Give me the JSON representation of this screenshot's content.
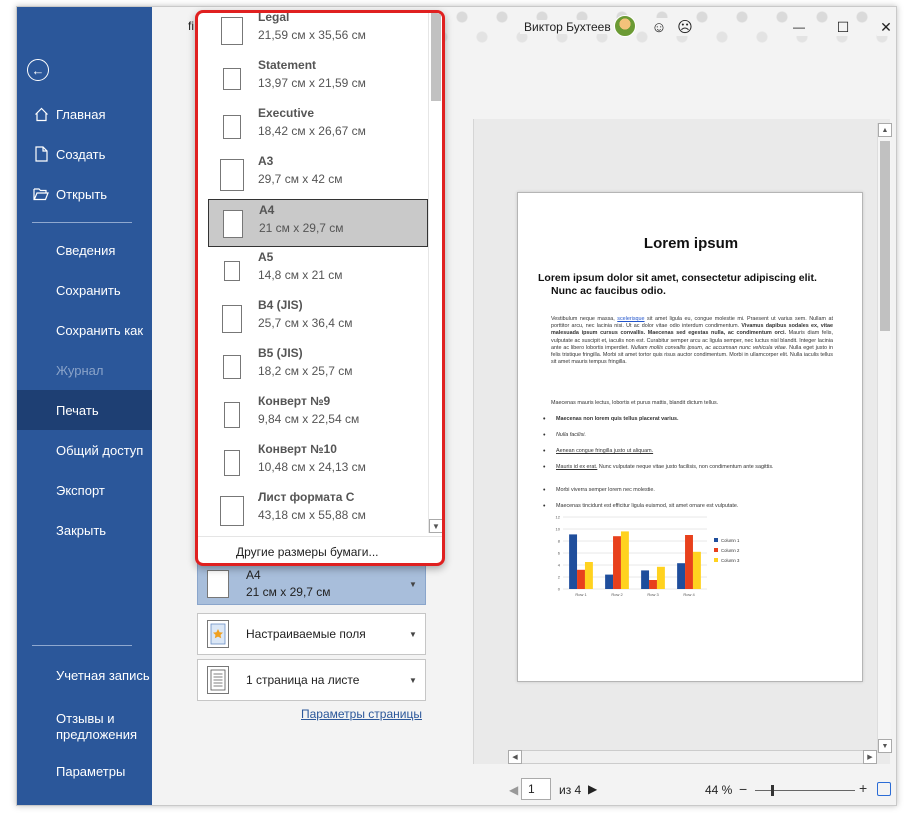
{
  "app": {
    "doc_title_fragment": "fi",
    "user_name": "Виктор Бухтеев",
    "smile_icon": "☺",
    "frown_icon": "☹",
    "minimize_icon": "—",
    "maximize_icon": "☐",
    "close_icon": "✕"
  },
  "sidebar": {
    "back_icon": "←",
    "items": [
      {
        "label": "Главная"
      },
      {
        "label": "Создать"
      },
      {
        "label": "Открыть"
      },
      {
        "label": "Сведения"
      },
      {
        "label": "Сохранить"
      },
      {
        "label": "Сохранить как"
      },
      {
        "label": "Журнал"
      },
      {
        "label": "Печать"
      },
      {
        "label": "Общий доступ"
      },
      {
        "label": "Экспорт"
      },
      {
        "label": "Закрыть"
      },
      {
        "label": "Учетная запись"
      },
      {
        "label": "Отзывы и предложения"
      },
      {
        "label": "Параметры"
      }
    ]
  },
  "dropdown": {
    "papers": [
      {
        "name": "Legal",
        "size": "21,59 см x 35,56 см"
      },
      {
        "name": "Statement",
        "size": "13,97 см x 21,59 см"
      },
      {
        "name": "Executive",
        "size": "18,42 см x 26,67 см"
      },
      {
        "name": "A3",
        "size": "29,7 см x 42 см"
      },
      {
        "name": "A4",
        "size": "21 см x 29,7 см"
      },
      {
        "name": "A5",
        "size": "14,8 см x 21 см"
      },
      {
        "name": "B4 (JIS)",
        "size": "25,7 см x 36,4 см"
      },
      {
        "name": "B5 (JIS)",
        "size": "18,2 см x 25,7 см"
      },
      {
        "name": "Конверт №9",
        "size": "9,84 см x 22,54 см"
      },
      {
        "name": "Конверт №10",
        "size": "10,48 см x 24,13 см"
      },
      {
        "name": "Лист формата C",
        "size": "43,18 см x 55,88 см"
      }
    ],
    "more_sizes": "Другие размеры бумаги...",
    "down_arrow": "▼"
  },
  "settings": {
    "paper": {
      "line1": "A4",
      "line2": "21 см x 29,7 см"
    },
    "margins": "Настраиваемые поля",
    "pages_per_sheet": "1 страница на листе",
    "arrow": "▼",
    "page_setup_link": "Параметры страницы"
  },
  "preview": {
    "title": "Lorem ipsum",
    "subtitle_1": "Lorem ipsum dolor sit amet, consectetur adipiscing elit.",
    "subtitle_2": "Nunc ac faucibus odio.",
    "para_1_a": "Vestibulum neque massa, ",
    "para_1_link": "scelerisque",
    "para_1_b": " sit amet ligula eu, congue molestie mi. Praesent ut varius sem. Nullam at porttitor arcu, nec lacinia nisi. Ut ac dolor vitae odio interdum condimentum. ",
    "para_1_bold": "Vivamus dapibus sodales ex, vitae malesuada ipsum cursus convallis. Maecenas sed egestas nulla, ac condimentum orci.",
    "para_1_c": " Mauris diam felis, vulputate ac suscipit et, iaculis non est. Curabitur semper arcu ac ligula semper, nec luctus nisl blandit. Integer lacinia ante ac libero lobortis imperdiet. ",
    "para_1_italic": "Nullam mollis convallis ipsum, ac accumsan nunc vehicula vitae.",
    "para_1_d": " Nulla eget justo in felis tristique fringilla. Morbi sit amet tortor quis risus auctor condimentum. Morbi in ullamcorper elit. Nulla iaculis tellus sit amet mauris tempus fringilla.",
    "para_2": "Maecenas mauris lectus, lobortis et purus mattis, blandit dictum tellus.",
    "bullets": {
      "b1": "Maecenas non lorem quis tellus placerat varius.",
      "b2": "Nulla facilisi.",
      "b3": "Aenean congue fringilla justo ut aliquam.",
      "b4_link": "Mauris id ex erat.",
      "b4_rest": " Nunc vulputate neque vitae justo facilisis, non condimentum ante sagittis.",
      "b5": "Morbi viverra semper lorem nec molestie.",
      "b6": "Maecenas tincidunt est efficitur ligula euismod, sit amet ornare est vulputate."
    },
    "scroll_up": "▲",
    "scroll_down": "▼",
    "scroll_left": "◀",
    "scroll_right": "▶"
  },
  "chart_data": {
    "type": "bar",
    "categories": [
      "Row 1",
      "Row 2",
      "Row 3",
      "Row 4"
    ],
    "series": [
      {
        "name": "Column 1",
        "values": [
          9.1,
          2.4,
          3.1,
          4.3
        ],
        "color": "#1f4e9c"
      },
      {
        "name": "Column 2",
        "values": [
          3.2,
          8.8,
          1.5,
          9.0
        ],
        "color": "#e8401c"
      },
      {
        "name": "Column 3",
        "values": [
          4.5,
          9.6,
          3.7,
          6.2
        ],
        "color": "#ffd21f"
      }
    ],
    "ylim": [
      0,
      12
    ],
    "yticks": [
      "0",
      "2",
      "4",
      "6",
      "8",
      "10",
      "12"
    ],
    "grid": true,
    "legend": "right"
  },
  "status": {
    "prev_arrow": "◀",
    "page_value": "1",
    "of_label": "из 4",
    "next_arrow": "▶",
    "zoom": "44 %",
    "zoom_minus": "−",
    "zoom_plus": "+"
  },
  "colors": {
    "sidebar": "#2b579a",
    "sidebar_active": "#1e3f73",
    "highlight_border": "#e02020",
    "selected_setting": "#a8bedb"
  }
}
